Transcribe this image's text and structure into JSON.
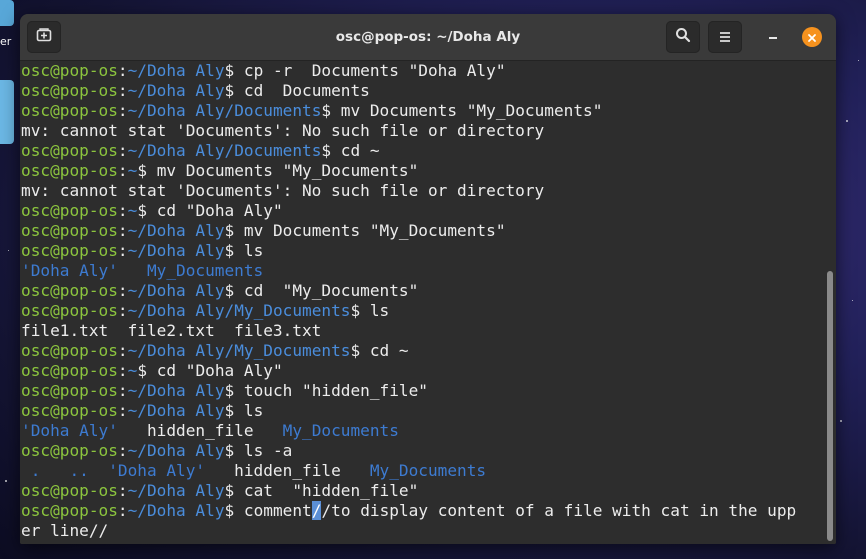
{
  "desktop": {
    "side_label": "er"
  },
  "window": {
    "title": "osc@pop-os: ~/Doha Aly"
  },
  "colors": {
    "user_host": "#8cc63e",
    "path": "#4a8ddc",
    "directory": "#3d7bd1",
    "close": "#f6921e"
  },
  "icons": {
    "new_tab": "new-tab-icon",
    "search": "search-icon",
    "menu": "hamburger-menu-icon",
    "minimize": "minimize-icon",
    "close": "close-icon"
  },
  "terminal": {
    "lines": [
      [
        {
          "t": "osc@pop-os",
          "c": "u"
        },
        {
          "t": ":",
          "c": "w"
        },
        {
          "t": "~/Doha Aly",
          "c": "p"
        },
        {
          "t": "$ cp -r  Documents \"Doha Aly\"",
          "c": "w"
        }
      ],
      [
        {
          "t": "osc@pop-os",
          "c": "u"
        },
        {
          "t": ":",
          "c": "w"
        },
        {
          "t": "~/Doha Aly",
          "c": "p"
        },
        {
          "t": "$ cd  Documents",
          "c": "w"
        }
      ],
      [
        {
          "t": "osc@pop-os",
          "c": "u"
        },
        {
          "t": ":",
          "c": "w"
        },
        {
          "t": "~/Doha Aly/Documents",
          "c": "p"
        },
        {
          "t": "$ mv Documents \"My_Documents\"",
          "c": "w"
        }
      ],
      [
        {
          "t": "mv: cannot stat 'Documents': No such file or directory",
          "c": "w"
        }
      ],
      [
        {
          "t": "osc@pop-os",
          "c": "u"
        },
        {
          "t": ":",
          "c": "w"
        },
        {
          "t": "~/Doha Aly/Documents",
          "c": "p"
        },
        {
          "t": "$ cd ~",
          "c": "w"
        }
      ],
      [
        {
          "t": "osc@pop-os",
          "c": "u"
        },
        {
          "t": ":",
          "c": "w"
        },
        {
          "t": "~",
          "c": "p"
        },
        {
          "t": "$ mv Documents \"My_Documents\"",
          "c": "w"
        }
      ],
      [
        {
          "t": "mv: cannot stat 'Documents': No such file or directory",
          "c": "w"
        }
      ],
      [
        {
          "t": "osc@pop-os",
          "c": "u"
        },
        {
          "t": ":",
          "c": "w"
        },
        {
          "t": "~",
          "c": "p"
        },
        {
          "t": "$ cd \"Doha Aly\"",
          "c": "w"
        }
      ],
      [
        {
          "t": "osc@pop-os",
          "c": "u"
        },
        {
          "t": ":",
          "c": "w"
        },
        {
          "t": "~/Doha Aly",
          "c": "p"
        },
        {
          "t": "$ mv Documents \"My_Documents\"",
          "c": "w"
        }
      ],
      [
        {
          "t": "osc@pop-os",
          "c": "u"
        },
        {
          "t": ":",
          "c": "w"
        },
        {
          "t": "~/Doha Aly",
          "c": "p"
        },
        {
          "t": "$ ls",
          "c": "w"
        }
      ],
      [
        {
          "t": "'Doha Aly'   My_Documents",
          "c": "dir"
        }
      ],
      [
        {
          "t": "osc@pop-os",
          "c": "u"
        },
        {
          "t": ":",
          "c": "w"
        },
        {
          "t": "~/Doha Aly",
          "c": "p"
        },
        {
          "t": "$ cd  \"My_Documents\"",
          "c": "w"
        }
      ],
      [
        {
          "t": "osc@pop-os",
          "c": "u"
        },
        {
          "t": ":",
          "c": "w"
        },
        {
          "t": "~/Doha Aly/My_Documents",
          "c": "p"
        },
        {
          "t": "$ ls",
          "c": "w"
        }
      ],
      [
        {
          "t": "file1.txt  file2.txt  file3.txt",
          "c": "w"
        }
      ],
      [
        {
          "t": "osc@pop-os",
          "c": "u"
        },
        {
          "t": ":",
          "c": "w"
        },
        {
          "t": "~/Doha Aly/My_Documents",
          "c": "p"
        },
        {
          "t": "$ cd ~",
          "c": "w"
        }
      ],
      [
        {
          "t": "osc@pop-os",
          "c": "u"
        },
        {
          "t": ":",
          "c": "w"
        },
        {
          "t": "~",
          "c": "p"
        },
        {
          "t": "$ cd \"Doha Aly\"",
          "c": "w"
        }
      ],
      [
        {
          "t": "osc@pop-os",
          "c": "u"
        },
        {
          "t": ":",
          "c": "w"
        },
        {
          "t": "~/Doha Aly",
          "c": "p"
        },
        {
          "t": "$ touch \"hidden_file\"",
          "c": "w"
        }
      ],
      [
        {
          "t": "osc@pop-os",
          "c": "u"
        },
        {
          "t": ":",
          "c": "w"
        },
        {
          "t": "~/Doha Aly",
          "c": "p"
        },
        {
          "t": "$ ls",
          "c": "w"
        }
      ],
      [
        {
          "t": "'Doha Aly'",
          "c": "dir"
        },
        {
          "t": "   hidden_file   ",
          "c": "w"
        },
        {
          "t": "My_Documents",
          "c": "dir"
        }
      ],
      [
        {
          "t": "osc@pop-os",
          "c": "u"
        },
        {
          "t": ":",
          "c": "w"
        },
        {
          "t": "~/Doha Aly",
          "c": "p"
        },
        {
          "t": "$ ls -a",
          "c": "w"
        }
      ],
      [
        {
          "t": " .   ..  'Doha Aly'",
          "c": "dir"
        },
        {
          "t": "   hidden_file   ",
          "c": "w"
        },
        {
          "t": "My_Documents",
          "c": "dir"
        }
      ],
      [
        {
          "t": "osc@pop-os",
          "c": "u"
        },
        {
          "t": ":",
          "c": "w"
        },
        {
          "t": "~/Doha Aly",
          "c": "p"
        },
        {
          "t": "$ cat  \"hidden_file\"",
          "c": "w"
        }
      ],
      [
        {
          "t": "osc@pop-os",
          "c": "u"
        },
        {
          "t": ":",
          "c": "w"
        },
        {
          "t": "~/Doha Aly",
          "c": "p"
        },
        {
          "t": "$ comment",
          "c": "w"
        },
        {
          "t": "/",
          "c": "cursor"
        },
        {
          "t": "/to display content of a file with cat in the upp",
          "c": "w"
        }
      ],
      [
        {
          "t": "er line//",
          "c": "w"
        }
      ]
    ]
  }
}
